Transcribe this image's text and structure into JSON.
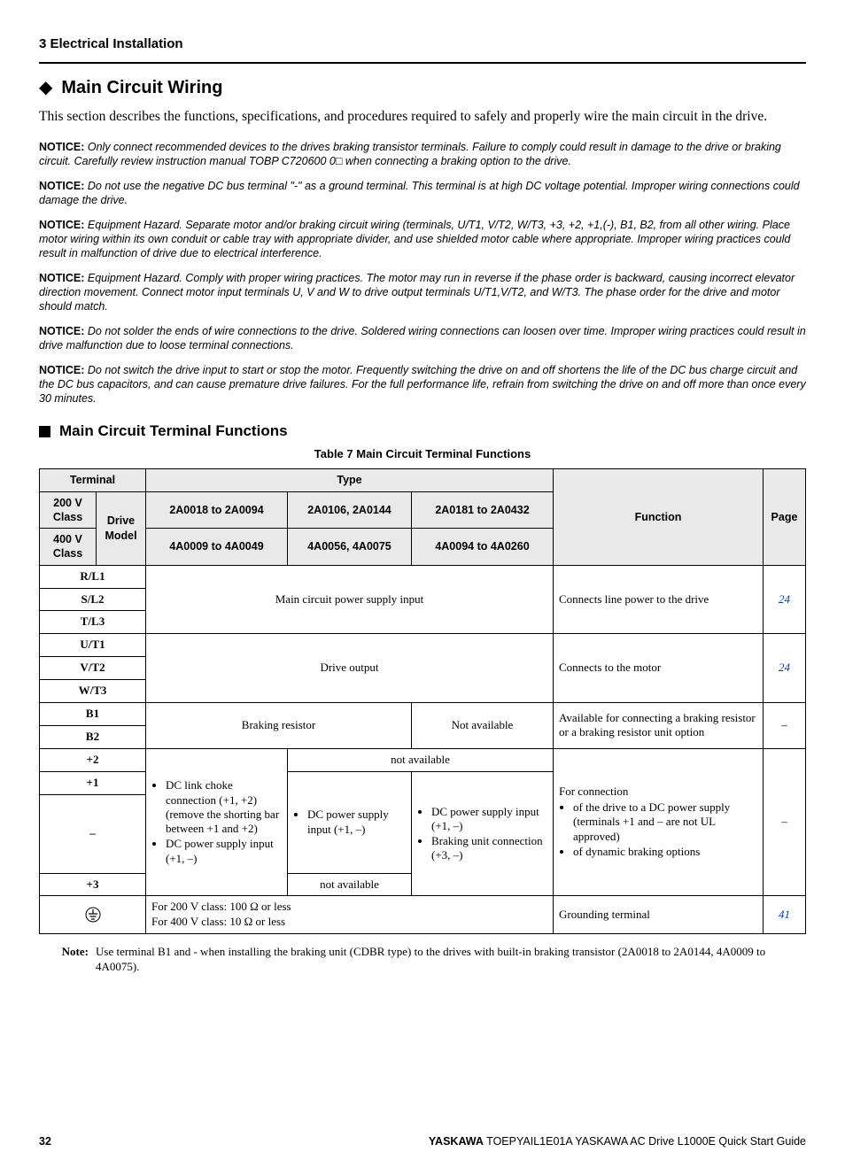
{
  "chapter": "3  Electrical Installation",
  "h1": "Main Circuit Wiring",
  "intro": "This section describes the functions, specifications, and procedures required to safely and properly wire the main circuit in the drive.",
  "notice_label": "NOTICE:",
  "notices": [
    "Only connect recommended devices to the drives braking transistor terminals. Failure to comply could result in damage to the drive or braking circuit. Carefully review instruction manual TOBP C720600 0□ when connecting a braking option to the drive.",
    "Do not use the negative DC bus terminal \"-\" as a ground terminal. This terminal is at high DC voltage potential. Improper wiring connections could damage the drive.",
    "Equipment Hazard. Separate motor and/or braking circuit wiring (terminals, U/T1, V/T2, W/T3, +3, +2, +1,(-), B1, B2, from all other wiring. Place motor wiring within its own conduit or cable tray with appropriate divider, and use shielded motor cable where appropriate. Improper wiring practices could result in malfunction of drive due to electrical interference.",
    "Equipment Hazard. Comply with proper wiring practices. The motor may run in reverse if the phase order is backward, causing incorrect elevator direction movement. Connect motor input terminals U, V and W to drive output terminals U/T1,V/T2, and W/T3. The phase order for the drive and motor should match.",
    "Do not solder the ends of wire connections to the drive. Soldered wiring connections can loosen over time. Improper wiring practices could result in drive malfunction due to loose terminal connections.",
    "Do not switch the drive input to start or stop the motor. Frequently switching the drive on and off shortens the life of the DC bus charge circuit and the DC bus capacitors, and can cause premature drive failures. For the full performance life, refrain from switching the drive on and off more than once every 30 minutes."
  ],
  "h2": "Main Circuit Terminal Functions",
  "table_caption": "Table 7  Main Circuit Terminal Functions",
  "headers": {
    "terminal": "Terminal",
    "type": "Type",
    "class200": "200 V Class",
    "class400": "400 V Class",
    "drive_model": "Drive Model",
    "r1c1": "2A0018 to 2A0094",
    "r1c2": "2A0106, 2A0144",
    "r1c3": "2A0181 to 2A0432",
    "r2c1": "4A0009 to 4A0049",
    "r2c2": "4A0056, 4A0075",
    "r2c3": "4A0094 to 4A0260",
    "function": "Function",
    "page": "Page"
  },
  "rows": {
    "power": {
      "t1": "R/L1",
      "t2": "S/L2",
      "t3": "T/L3",
      "type": "Main circuit power supply input",
      "func": "Connects line power to the drive",
      "page": "24"
    },
    "output": {
      "t1": "U/T1",
      "t2": "V/T2",
      "t3": "W/T3",
      "type": "Drive output",
      "func": "Connects to the motor",
      "page": "24"
    },
    "brake": {
      "t1": "B1",
      "t2": "B2",
      "type": "Braking resistor",
      "na": "Not available",
      "func": "Available for connecting a braking resistor or a braking resistor unit option",
      "page": "–"
    },
    "dc": {
      "tplus2": "+2",
      "tplus1": "+1",
      "tminus": "–",
      "tplus3": "+3",
      "na23_top": "not available",
      "col1_li1": "DC link choke connection (+1, +2) (remove the shorting bar between +1 and +2)",
      "col1_li2": "DC power supply input (+1, –)",
      "col2_li1": "DC power supply input (+1, –)",
      "col3_li1": "DC power supply input (+1, –)",
      "col3_li2": "Braking unit connection (+3, –)",
      "na12_bottom": "not available",
      "func_intro": "For connection",
      "func_li1": "of the drive to a DC power supply (terminals +1 and – are not UL approved)",
      "func_li2": "of dynamic braking options",
      "page": "–"
    },
    "ground": {
      "type": "For 200 V class: 100 Ω or less\nFor 400 V class: 10 Ω or less",
      "type_l1": "For 200 V class: 100 Ω or less",
      "type_l2": "For 400 V class: 10 Ω or less",
      "func": "Grounding terminal",
      "page": "41"
    }
  },
  "note_label": "Note:",
  "note_body": "Use terminal B1 and - when installing the braking unit (CDBR type) to the drives with built-in braking transistor (2A0018 to 2A0144, 4A0009 to 4A0075).",
  "footer": {
    "page": "32",
    "brand": "YASKAWA",
    "doc": " TOEPYAIL1E01A YASKAWA AC Drive L1000E Quick Start Guide"
  }
}
